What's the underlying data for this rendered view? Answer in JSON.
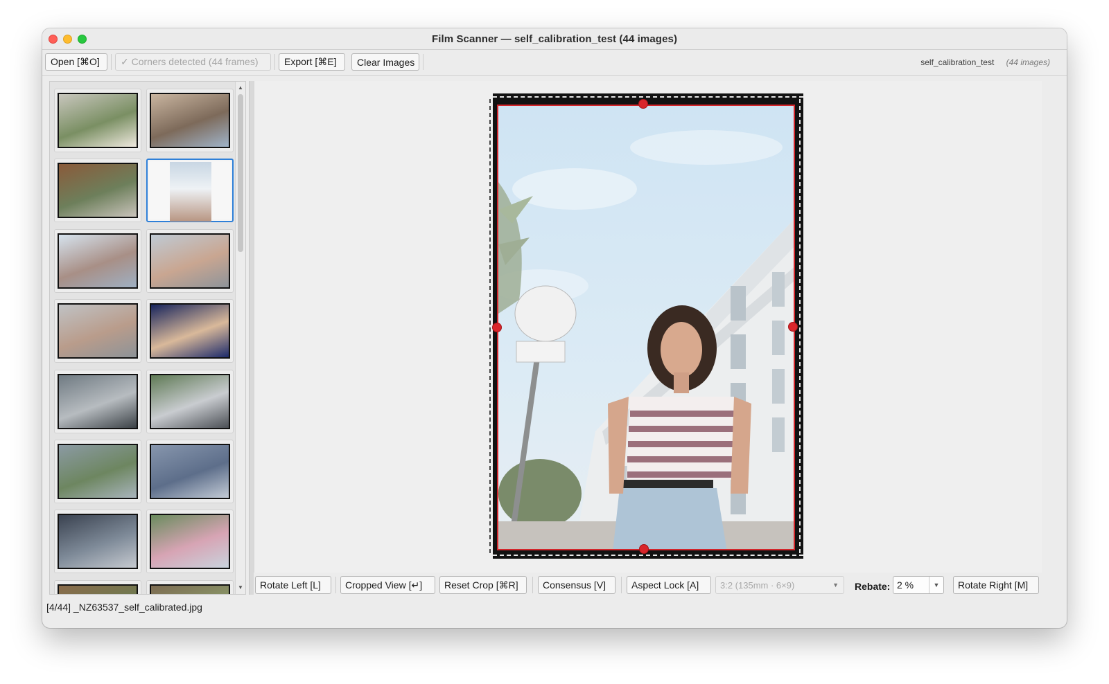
{
  "window": {
    "title": "Film Scanner — self_calibration_test  (44 images)"
  },
  "toolbar": {
    "open_label": "Open  [⌘O]",
    "corners_label": "✓ Corners detected  (44 frames)",
    "export_label": "Export  [⌘E]",
    "clear_label": "Clear Images",
    "project_name": "self_calibration_test",
    "project_count": "(44 images)"
  },
  "thumbnails": [
    {
      "icon": "photo-building-trees",
      "selected": false
    },
    {
      "icon": "photo-person-lying",
      "selected": false
    },
    {
      "icon": "photo-woman-fence",
      "selected": false
    },
    {
      "icon": "photo-woman-portrait",
      "selected": true
    },
    {
      "icon": "photo-woman-rotated",
      "selected": false
    },
    {
      "icon": "photo-woman-street",
      "selected": false
    },
    {
      "icon": "photo-woman-wall",
      "selected": false
    },
    {
      "icon": "photo-graffiti-dark",
      "selected": false
    },
    {
      "icon": "photo-crowd-cars",
      "selected": false
    },
    {
      "icon": "photo-crowd-trees",
      "selected": false
    },
    {
      "icon": "photo-street-cyclist",
      "selected": false
    },
    {
      "icon": "photo-fabric-blue",
      "selected": false
    },
    {
      "icon": "photo-crowd-arch",
      "selected": false
    },
    {
      "icon": "photo-car-trees",
      "selected": false
    },
    {
      "icon": "photo-partial-1",
      "selected": false
    },
    {
      "icon": "photo-partial-2",
      "selected": false
    }
  ],
  "controls": {
    "rotate_left": "Rotate Left  [L]",
    "cropped_view": "Cropped View  [↵]",
    "reset_crop": "Reset Crop  [⌘R]",
    "consensus": "Consensus  [V]",
    "aspect_lock": "Aspect Lock  [A]",
    "aspect_ratio": "3:2  (135mm · 6×9)",
    "rebate_label": "Rebate:",
    "rebate_value": "2 %",
    "rotate_right": "Rotate Right  [M]"
  },
  "status": {
    "text": "[4/44]   _NZ63537_self_calibrated.jpg"
  },
  "colors": {
    "crop_border": "#d3252a",
    "selection": "#2f80d8"
  }
}
